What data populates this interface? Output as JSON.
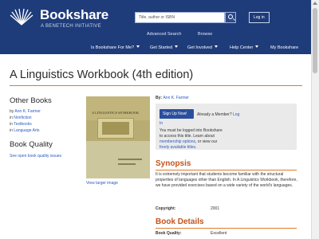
{
  "header": {
    "brand": "Bookshare",
    "tagline": "A BENETECH INITIATIVE",
    "search_placeholder": "Title, author or ISBN",
    "login": "Log in",
    "sub_links": [
      "Advanced Search",
      "Browse"
    ],
    "nav": [
      {
        "label": "Is Bookshare For Me?",
        "dropdown": true
      },
      {
        "label": "Get Started",
        "dropdown": true
      },
      {
        "label": "Get Involved",
        "dropdown": true
      },
      {
        "label": "Help Center",
        "dropdown": true
      },
      {
        "label": "My Bookshare",
        "dropdown": false
      }
    ]
  },
  "page_title": "A Linguistics Workbook (4th edition)",
  "sidebar": {
    "other_books_heading": "Other Books",
    "other_books": [
      {
        "prefix": "by ",
        "link": "Ann K. Farmer"
      },
      {
        "prefix": "in ",
        "link": "Nonfiction"
      },
      {
        "prefix": "in ",
        "link": "Textbooks"
      },
      {
        "prefix": "in ",
        "link": "Language Arts"
      }
    ],
    "quality_heading": "Book Quality",
    "quality_link": "See open book quality issues"
  },
  "cover": {
    "alt_title": "A LINGUISTICS WORKBOOK",
    "view_larger": "View larger image"
  },
  "book": {
    "by_label": "By:",
    "author": "Ann K. Farmer",
    "signup_button": "Sign Up Now!",
    "already_member": "Already a Member?",
    "login_link": "Log",
    "login_link_2": "In",
    "signup_text_1": "You must be logged into Bookshare to access this title. Learn about ",
    "signup_link_1": "membership options",
    "signup_text_2": ", or view our ",
    "signup_link_2": "freely available titles",
    "signup_text_3": "."
  },
  "synopsis": {
    "heading": "Synopsis",
    "text": "It is extremely important that students become familiar with the structural properties of languages other than English. In A Linguistics Workbook, therefore, we have provided exercises based on a wide variety of the world's languages."
  },
  "copyright": {
    "label": "Copyright:",
    "value": "2001"
  },
  "details": {
    "heading": "Book Details",
    "quality_label": "Book Quality:",
    "quality_value": "Excellent"
  },
  "colors": {
    "header_bg": "#1f3c7a",
    "accent": "#c2541b",
    "link": "#2b5ac0"
  }
}
